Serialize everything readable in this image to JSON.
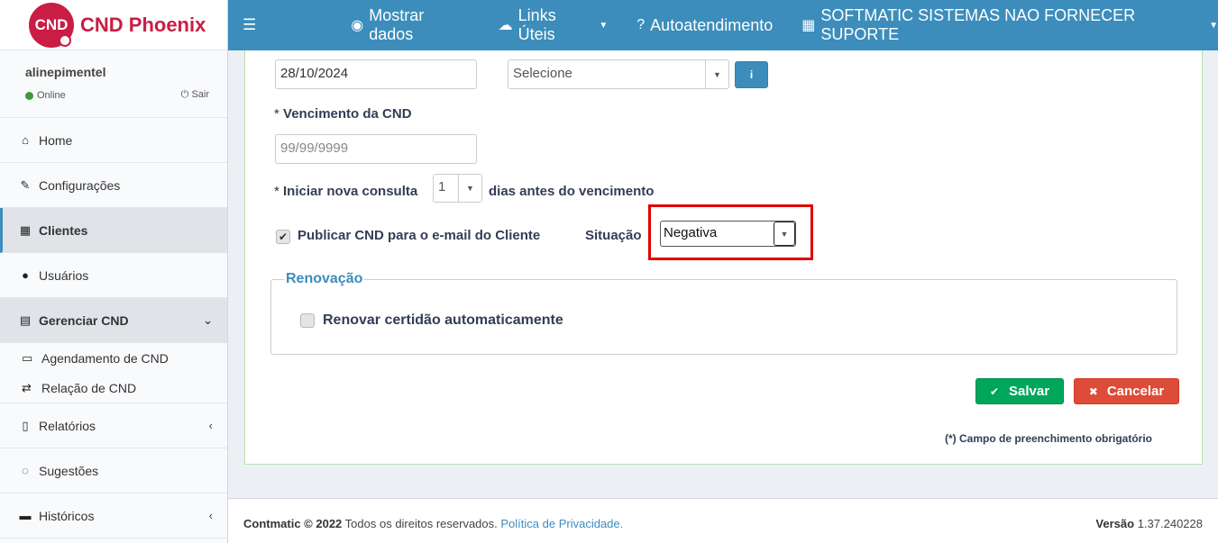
{
  "brand": {
    "logo_text": "CND",
    "name": "CND Phoenix"
  },
  "user": {
    "name": "alinepimentel",
    "status": "Online",
    "logout": "Sair"
  },
  "sidebar": {
    "items": [
      {
        "label": "Home",
        "icon": "home-icon"
      },
      {
        "label": "Configurações",
        "icon": "wrench-icon"
      },
      {
        "label": "Clientes",
        "icon": "building-icon"
      },
      {
        "label": "Usuários",
        "icon": "user-icon"
      },
      {
        "label": "Gerenciar CND",
        "icon": "calendar-icon"
      },
      {
        "label": "Relatórios",
        "icon": "document-icon"
      },
      {
        "label": "Sugestões",
        "icon": "comments-icon"
      },
      {
        "label": "Históricos",
        "icon": "archive-icon"
      }
    ],
    "subitems": [
      {
        "label": "Agendamento de CND",
        "icon": "calendar-outline-icon"
      },
      {
        "label": "Relação de CND",
        "icon": "retweet-icon"
      }
    ]
  },
  "header": {
    "show_data": "Mostrar dados",
    "links": "Links Úteis",
    "self_service": "Autoatendimento",
    "company": "SOFTMATIC SISTEMAS NAO FORNECER SUPORTE"
  },
  "form": {
    "date_value": "28/10/2024",
    "select_placeholder": "Selecione",
    "info_label": "i",
    "expiry_label": "Vencimento da CND",
    "required_mark": "*",
    "expiry_placeholder": "99/99/9999",
    "new_query_label": "Iniciar nova consulta",
    "new_query_days": "1",
    "new_query_suffix": "dias antes do vencimento",
    "publish_label": "Publicar CND para o e-mail do Cliente",
    "situation_label": "Situação",
    "situation_value": "Negativa",
    "renewal_legend": "Renovação",
    "renewal_label": "Renovar certidão automaticamente",
    "save": "Salvar",
    "cancel": "Cancelar",
    "required_note": "(*) Campo de preenchimento obrigatório"
  },
  "footer": {
    "copyright_brand": "Contmatic © 2022",
    "rights": "Todos os direitos reservados.",
    "privacy": "Política de Privacidade.",
    "version_label": "Versão",
    "version": "1.37.240228"
  },
  "colors": {
    "primary": "#3c8dbc",
    "brand": "#c91d45",
    "success": "#00a65a",
    "danger": "#dd4b39",
    "highlight": "#e00000"
  }
}
